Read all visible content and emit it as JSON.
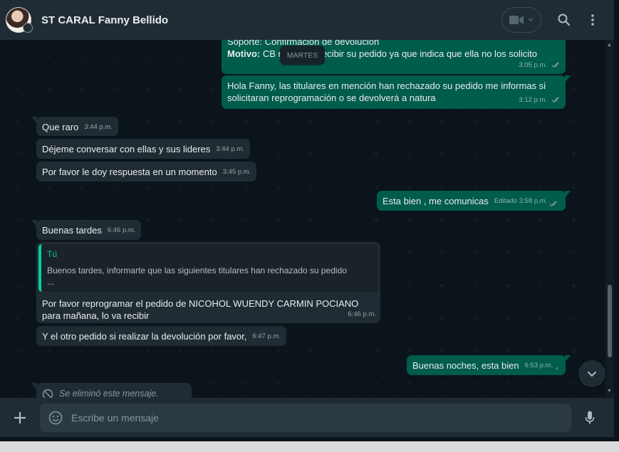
{
  "header": {
    "contact_name": "ST CARAL Fanny Bellido"
  },
  "chat": {
    "date_chip": "MARTES",
    "partial_top": {
      "line1": "Soporte: Confirmación de devolución",
      "label": "Motivo:",
      "text": "CB no desea recibir su pedido ya que indica que ella no los solicito",
      "time": "3:05 p.m."
    },
    "messages": [
      {
        "dir": "out",
        "text": "Hola Fanny, las titulares en mención han rechazado su pedido me informas si solicitaran reprogramación o se devolverá a natura",
        "time": "3:12 p.m."
      },
      {
        "dir": "in",
        "text": "Que raro",
        "time": "3:44 p.m."
      },
      {
        "dir": "in",
        "text": "Déjeme conversar con ellas y sus lideres",
        "time": "3:44 p.m."
      },
      {
        "dir": "in",
        "text": "Por favor le doy respuesta en un momento",
        "time": "3:45 p.m."
      },
      {
        "dir": "out",
        "text": "Esta bien , me comunicas",
        "edited": "Editado",
        "time": "3:58 p.m."
      },
      {
        "dir": "in",
        "text": "Buenas tardes",
        "time": "6:46 p.m."
      },
      {
        "dir": "in",
        "text": "Por favor reprogramar el pedido de NICOHOL WUENDY CARMIN POCIANO para mañana, lo va recibir",
        "time": "6:46 p.m.",
        "quote": {
          "author": "Tú",
          "text": "Buenos tardes, informarte que las siguientes titulares han rechazado su pedido",
          "more": "..."
        }
      },
      {
        "dir": "in",
        "text": "Y el otro pedido si realizar la devolución por favor,",
        "time": "6:47 p.m."
      },
      {
        "dir": "out",
        "text": "Buenas noches, esta bien",
        "time": "6:53 p.m."
      },
      {
        "dir": "in",
        "text": "Se eliminó este mensaje."
      }
    ]
  },
  "composer": {
    "placeholder": "Escribe un mensaje"
  },
  "icons": {
    "video": "video-camera-icon",
    "search": "search-icon",
    "menu": "more-vertical-icon",
    "plus": "plus-icon",
    "sticker": "sticker-icon",
    "mic": "microphone-icon",
    "scroll_down": "chevron-down-icon"
  },
  "colors": {
    "header_bg": "#202c33",
    "chat_bg": "#0b141a",
    "incoming_bubble": "#202c33",
    "outgoing_bubble": "#005c4b",
    "accent": "#06cf9c",
    "read_ticks": "#8696a0"
  }
}
